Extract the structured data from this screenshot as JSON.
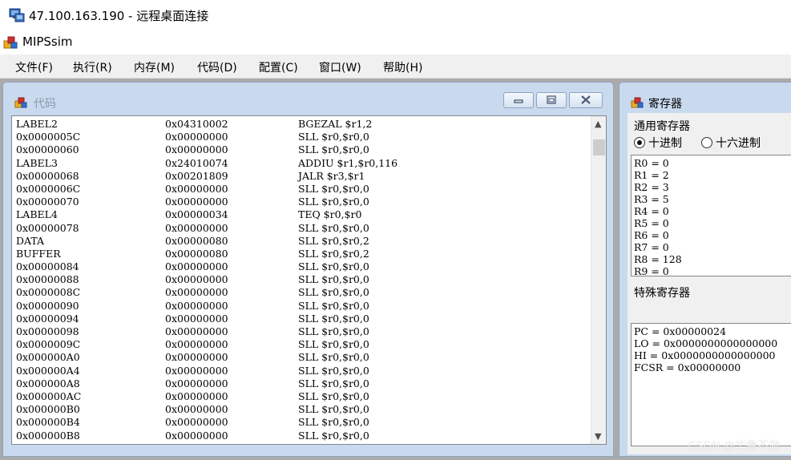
{
  "remote_desktop": {
    "title": "47.100.163.190 - 远程桌面连接"
  },
  "app": {
    "title": "MIPSsim"
  },
  "menu": [
    {
      "label": "文件(F)"
    },
    {
      "label": "执行(R)"
    },
    {
      "label": "内存(M)"
    },
    {
      "label": "代码(D)"
    },
    {
      "label": "配置(C)"
    },
    {
      "label": "窗口(W)"
    },
    {
      "label": "帮助(H)"
    }
  ],
  "code_window": {
    "title": "代码",
    "rows": [
      {
        "label": "LABEL2",
        "hex": "0x04310002",
        "instr": "BGEZAL $r1,2"
      },
      {
        "label": "0x0000005C",
        "hex": "0x00000000",
        "instr": "SLL $r0,$r0,0"
      },
      {
        "label": "0x00000060",
        "hex": "0x00000000",
        "instr": "SLL $r0,$r0,0"
      },
      {
        "label": "LABEL3",
        "hex": "0x24010074",
        "instr": "ADDIU $r1,$r0,116"
      },
      {
        "label": "0x00000068",
        "hex": "0x00201809",
        "instr": "JALR $r3,$r1"
      },
      {
        "label": "0x0000006C",
        "hex": "0x00000000",
        "instr": "SLL $r0,$r0,0"
      },
      {
        "label": "0x00000070",
        "hex": "0x00000000",
        "instr": "SLL $r0,$r0,0"
      },
      {
        "label": "LABEL4",
        "hex": "0x00000034",
        "instr": "TEQ $r0,$r0"
      },
      {
        "label": "0x00000078",
        "hex": "0x00000000",
        "instr": "SLL $r0,$r0,0"
      },
      {
        "label": "DATA",
        "hex": "0x00000080",
        "instr": "SLL $r0,$r0,2"
      },
      {
        "label": "BUFFER",
        "hex": "0x00000080",
        "instr": "SLL $r0,$r0,2"
      },
      {
        "label": "0x00000084",
        "hex": "0x00000000",
        "instr": "SLL $r0,$r0,0"
      },
      {
        "label": "0x00000088",
        "hex": "0x00000000",
        "instr": "SLL $r0,$r0,0"
      },
      {
        "label": "0x0000008C",
        "hex": "0x00000000",
        "instr": "SLL $r0,$r0,0"
      },
      {
        "label": "0x00000090",
        "hex": "0x00000000",
        "instr": "SLL $r0,$r0,0"
      },
      {
        "label": "0x00000094",
        "hex": "0x00000000",
        "instr": "SLL $r0,$r0,0"
      },
      {
        "label": "0x00000098",
        "hex": "0x00000000",
        "instr": "SLL $r0,$r0,0"
      },
      {
        "label": "0x0000009C",
        "hex": "0x00000000",
        "instr": "SLL $r0,$r0,0"
      },
      {
        "label": "0x000000A0",
        "hex": "0x00000000",
        "instr": "SLL $r0,$r0,0"
      },
      {
        "label": "0x000000A4",
        "hex": "0x00000000",
        "instr": "SLL $r0,$r0,0"
      },
      {
        "label": "0x000000A8",
        "hex": "0x00000000",
        "instr": "SLL $r0,$r0,0"
      },
      {
        "label": "0x000000AC",
        "hex": "0x00000000",
        "instr": "SLL $r0,$r0,0"
      },
      {
        "label": "0x000000B0",
        "hex": "0x00000000",
        "instr": "SLL $r0,$r0,0"
      },
      {
        "label": "0x000000B4",
        "hex": "0x00000000",
        "instr": "SLL $r0,$r0,0"
      },
      {
        "label": "0x000000B8",
        "hex": "0x00000000",
        "instr": "SLL $r0,$r0,0"
      }
    ]
  },
  "register_window": {
    "title": "寄存器",
    "general_label": "通用寄存器",
    "radio_decimal": "十进制",
    "radio_hex": "十六进制",
    "general_registers": [
      "R0 = 0",
      "R1 = 2",
      "R2 = 3",
      "R3 = 5",
      "R4 = 0",
      "R5 = 0",
      "R6 = 0",
      "R7 = 0",
      "R8 = 128",
      "R9 = 0"
    ],
    "special_label": "特殊寄存器",
    "special_registers": [
      "PC = 0x00000024",
      "LO = 0x0000000000000000",
      "HI = 0x0000000000000000",
      "FCSR = 0x00000000"
    ]
  },
  "watermark": "CSDN @华章不做"
}
